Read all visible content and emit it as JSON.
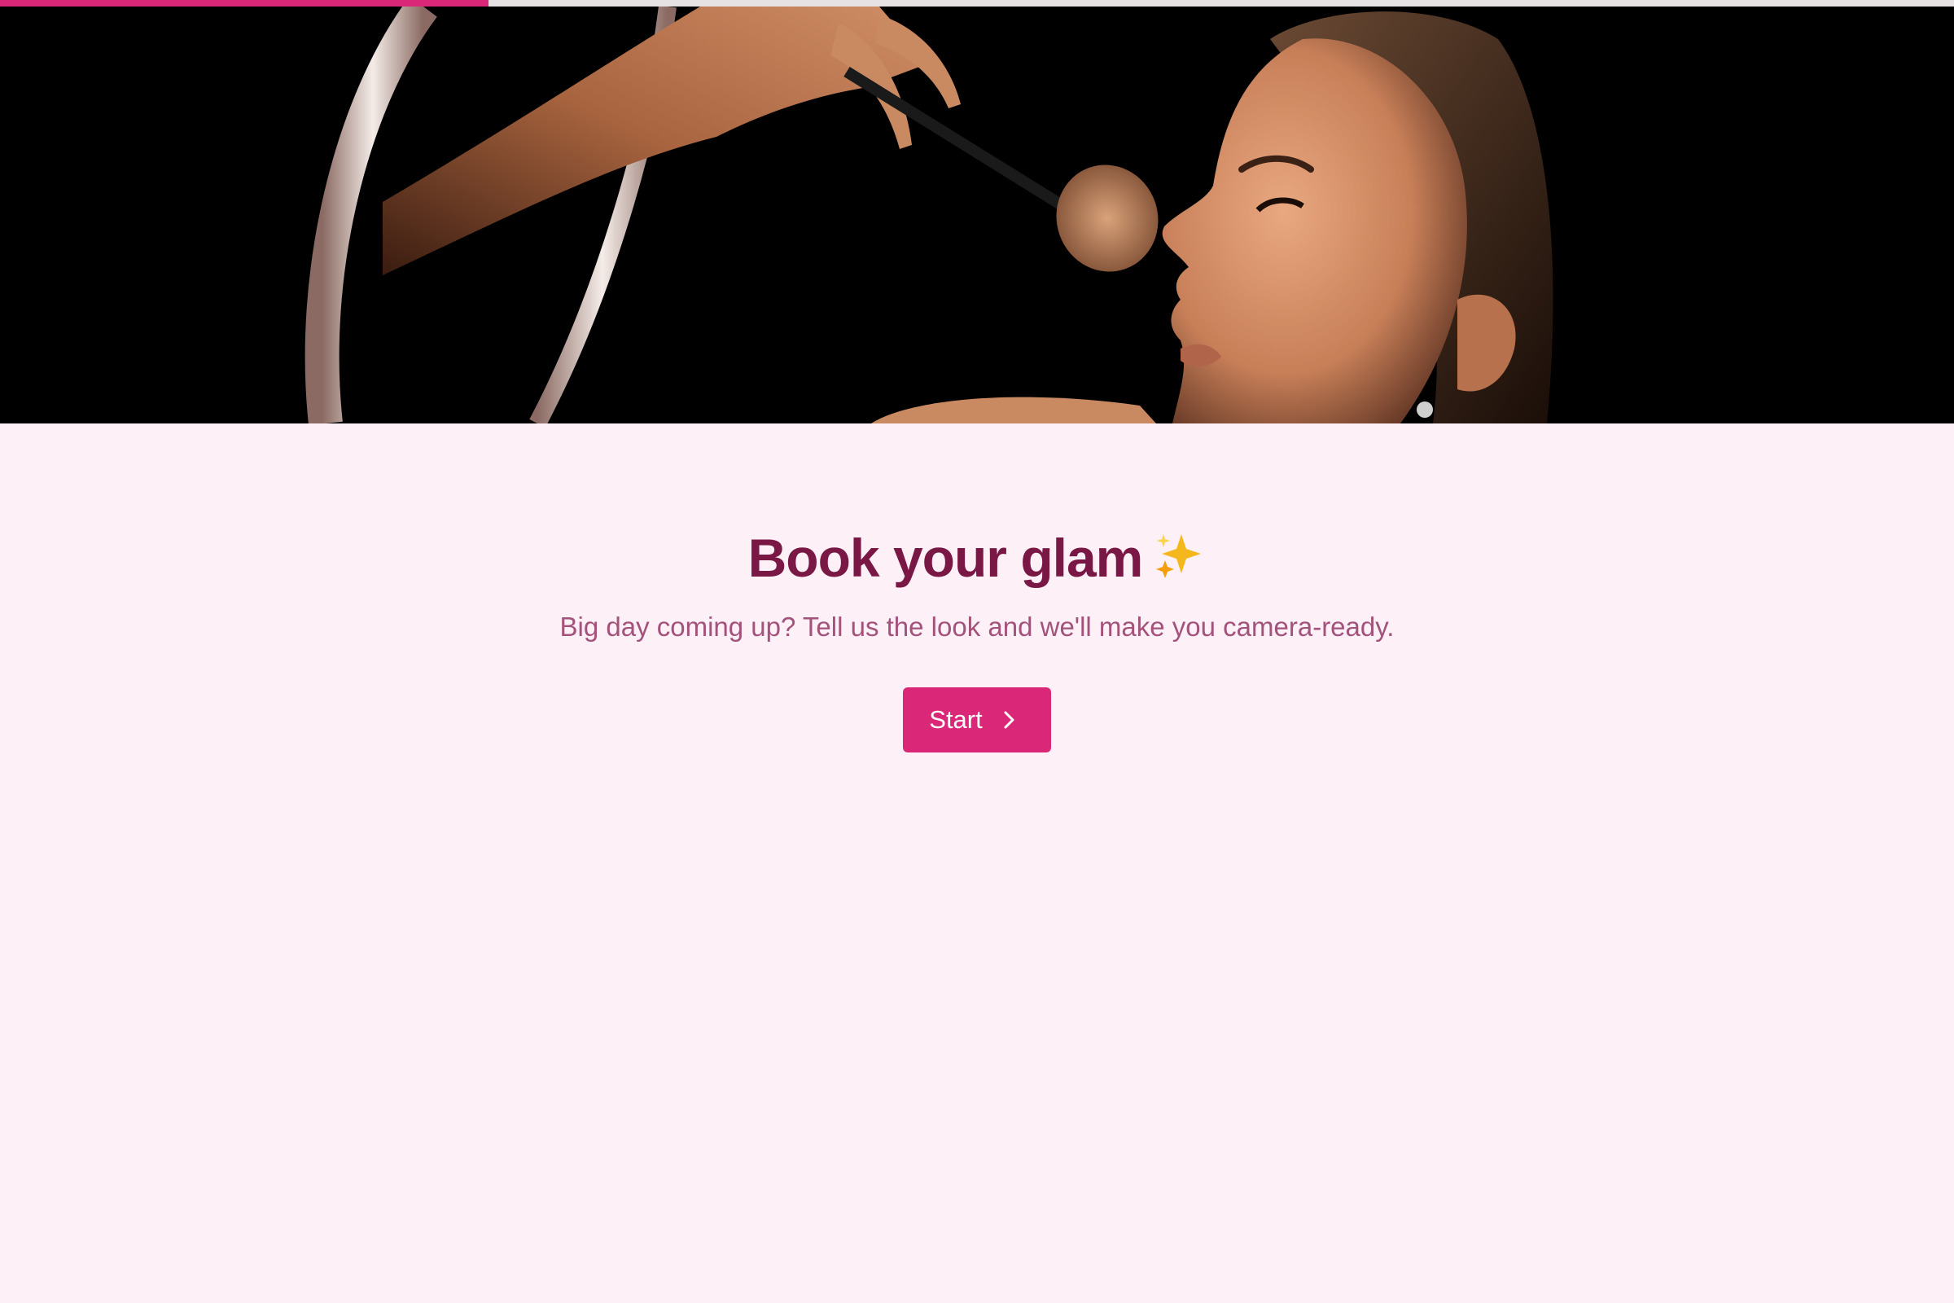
{
  "progress": {
    "fraction": 0.25,
    "color": "#db2777"
  },
  "hero": {
    "icon": "makeup-artist-photo",
    "alt_visible": ""
  },
  "welcome": {
    "title": "Book your glam",
    "title_emoji_icon": "sparkles-icon",
    "subtitle": "Big day coming up? Tell us the look and we'll make you camera-ready.",
    "start_label": "Start",
    "start_icon": "chevron-right-icon"
  },
  "colors": {
    "background": "#fdf0f6",
    "title": "#7a1845",
    "subtitle": "#a3527b",
    "accent": "#db2777"
  }
}
